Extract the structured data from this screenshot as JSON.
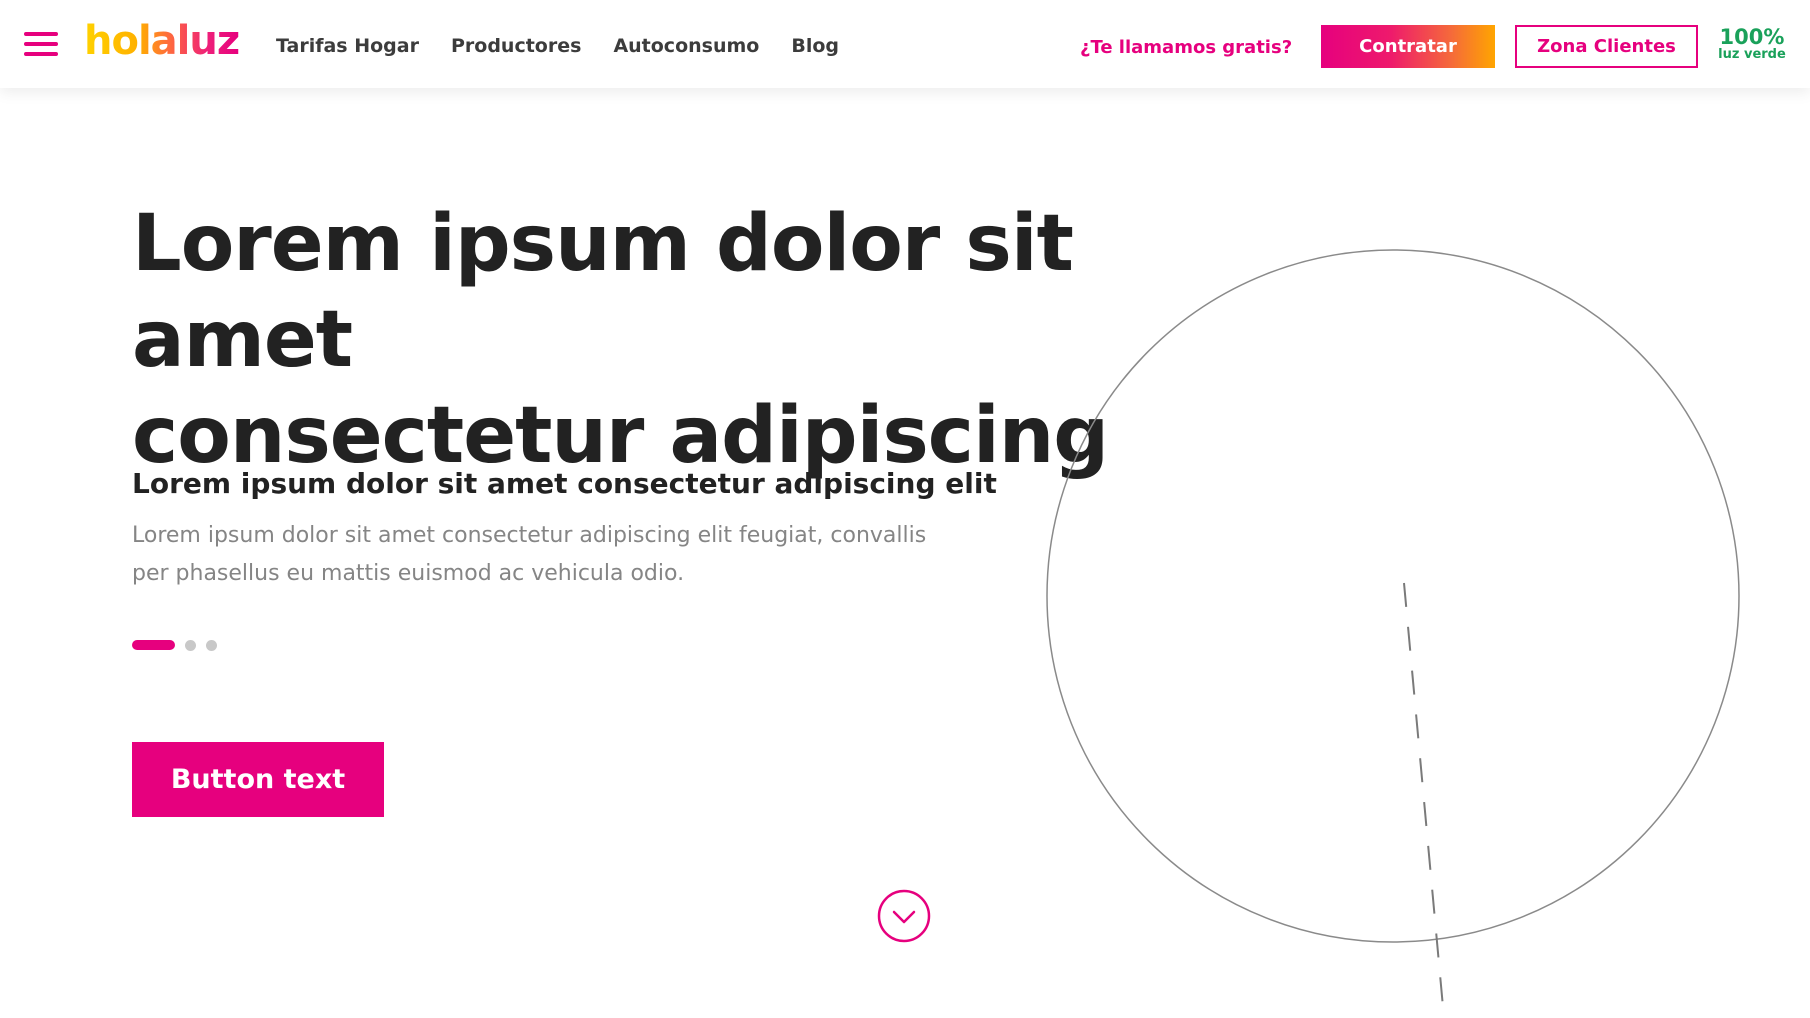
{
  "header": {
    "logo_text": "holaluz",
    "nav": [
      {
        "label": "Tarifas Hogar"
      },
      {
        "label": "Productores"
      },
      {
        "label": "Autoconsumo"
      },
      {
        "label": "Blog"
      }
    ],
    "callback_label": "¿Te llamamos gratis?",
    "contratar_label": "Contratar",
    "zona_clientes_label": "Zona Clientes",
    "badge": {
      "percent": "100%",
      "text": "luz verde"
    }
  },
  "hero": {
    "title_line1": "Lorem ipsum dolor sit amet",
    "title_line2": "consectetur adipiscing",
    "subtitle": "Lorem ipsum dolor sit amet consectetur adipiscing elit",
    "body": "Lorem ipsum dolor sit amet consectetur adipiscing elit feugiat, convallis per phasellus eu mattis euismod ac vehicula odio.",
    "carousel": {
      "count": 3,
      "active": 1
    },
    "button_label": "Button text"
  },
  "colors": {
    "brand_pink": "#e6007e",
    "brand_orange": "#ffa500",
    "brand_yellow": "#ffd200",
    "green": "#1aa15a",
    "title_text": "#222222",
    "body_text": "#858585",
    "inactive_dot": "#c8c8c8"
  },
  "icons": {
    "menu": "hamburger-menu-icon",
    "scroll": "chevron-down-circle-icon"
  }
}
